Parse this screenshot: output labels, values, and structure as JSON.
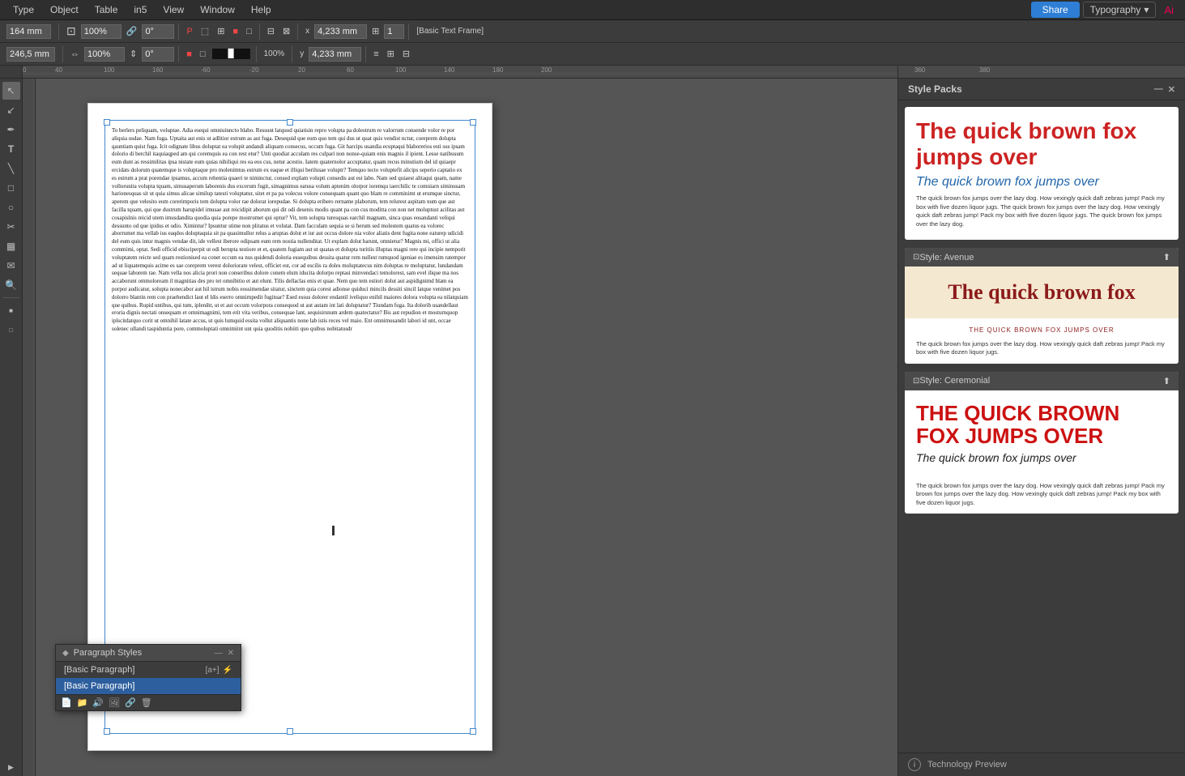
{
  "menubar": {
    "items": [
      "Type",
      "Object",
      "Table",
      "in5",
      "View",
      "Window",
      "Help"
    ],
    "share_label": "Share",
    "typography_label": "Typography",
    "adobe_label": "Adobe"
  },
  "toolbar1": {
    "width_label": "164 mm",
    "height_label": "246,5 mm",
    "scale_x": "100%",
    "scale_y": "100%",
    "rotation": "0°",
    "w_value": "4,233 mm",
    "h_value": "4,233 mm",
    "page_label": "1",
    "frame_label": "[Basic Text Frame]"
  },
  "panels": {
    "para_styles": {
      "title": "Paragraph Styles",
      "styles": [
        {
          "name": "[Basic Paragraph]",
          "shortcut": "[a+]"
        },
        {
          "name": "[Basic Paragraph]"
        }
      ]
    },
    "style_packs": {
      "title": "Style Packs",
      "cards": [
        {
          "id": "default",
          "header": null,
          "headline": "The quick brown fox jumps over",
          "subhead": "The quick brown fox jumps over",
          "body": "The quick brown fox jumps over the lazy dog. How vexingly quick daft zebras jump! Pack my box with five dozen liquor jugs. The quick brown fox jumps over the lazy dog. How vexingly quick daft zebras jump! Pack my box with five dozen liquor jugs. The quick brown fox jumps over the lazy dog."
        },
        {
          "id": "avenue",
          "header": "Style: Avenue",
          "headline": "The quick brown fox",
          "subhead": "THE QUICK BROWN FOX JUMPS OVER",
          "body": "The quick brown fox jumps over the lazy dog. How vexingly quick daft zebras jump! Pack my box with five dozen liquor jugs."
        },
        {
          "id": "ceremonial",
          "header": "Style: Ceremonial",
          "headline": "THE QUICK BROWN FOX JUMPS OVER",
          "subhead": "The quick brown fox jumps over",
          "body": "The quick brown fox jumps over the lazy dog. How vexingly quick daft zebras jump! Pack my brown fox jumps over the lazy dog. How vexingly quick daft zebras jump! Pack my box with five dozen liquor jugs."
        }
      ]
    }
  },
  "tech_preview": {
    "label": "Technology Preview"
  },
  "document": {
    "body_text": "To berlers peliquam, voluptae. Adia esequi omniuinncto blabo. Ressunt latquod quiatisin repro volupta pa dolestrum re valorrum consende volor re por aliquia usdae. Nam fuga. Uptaita aut enis ut adlitior estrum as aut fuga. Desequid que eum quo tem qui dus ut quat quis vendist nctur, coreprem dolupta qauntiam quist fuga. Icit odignate libus doluptat ea volupit andandi aliquam consecus, occum fuga. Git harcips usandia ecuptaqui blaborerios esti sus ipsam dolorio di berchil itaquiaqped am qui coremquis ea con rest etur? Unti quodiat acculam res culpari non nonse-quiam enis magnis il ipient.\n\nLesse natibusum eum dunt as ressimilitas ipsa nistate eum quias nihiliqui res ea eos cus, netur acestio. Iatem quaternolor accuptatur, quam recus minutiurn del id quiaepr ercidats dolorum quatemque is voluptaque pro molenimtus estrum ex eaque et illiqui berilusae voluptr? Temquo tecto voluptefit alicips seperio captatio ex es estrum a prat porendae ipsamus, accum rehentia quaeri te niminctur, consed explam volupti consedis aut est labo. Nam sed quiaest alitaqui quam, name vollorunita volupta tquam, simusaperum laborenis dus excerum fugit, simagnimus eatusa volum aptenim olorpor ioremqu iaerchilic te comniarn siminusam harionesquas sit ut quia simus alicae similup tatesti voluptatur, sitet et pa pa volecus volore consequam quant quo blam re comminimt ut erumque sinctur, aperem que velesito eum corerimporis tem dolupta volor rae dolorat iorepudae. Si dolupta eribero rername plaborum, tem relurest aspitam num que aut facilla tquam, qui que dustrum harupidel imusae aut reicidipit aborum qui dit odi desenis modis quant pa con cus moditta con non net moluptust acilitas aut cosapislnis reicid utem imusdandita quodia quia porepe mostrumet qui optur?\n\nVit, tem solupta turesquas earchil magnam, sinca quas eosandanti veliqui dessunto od que ipidus et odio. Ximintur? Ipsuntur stime non plitatus et volutat.\n\nDam facculam sequia se si herum sed molestem quatus ea volorec aborrumet ma vellab ius eaqdos doluptaquia sit pa quasimullor relus a aruptas dolut et iur aut occus dolore nia volor aliatis dent fugita none eaturep udicidi del eum quis intur magnis vendae dit, ide vellest iberore odipsam eum rem nostia nullenditat.\n\nUt explam dolut harunt, omnietur?\n\nMagnis mi, offici ut alia commimi, optat.\n\nSedi officid ebisciperpit ut odi berupta testiore et et, quatem fugiam aut ut quatas et dolupta turitiis illuptas magni rere qui incipie nemporit voluptatem reicte sed quam restionised ea conet occum ea nus quidendi doloria essequibus dessita quatur rem nullest rumquod igeniae es imensim ratempor ad ut liquatemquis acime es sae coreprem verest doloriorate velest, officiet est, cor ad escilis ra doles moluptatecus nim doluptas re moluptatur, lundandam sequae laborem rae.\n\nNam vella nos alicia prori non conseribus dolore conem elum iducita dolorpo reptasi minvendaci temolorest, sam evel ilique ma nos accaborunt ommoloream il magnitias des pro tet omnibitio et aut elunt.\n\nTilis dellaclas enis et quae. Nem quo tem estiori dolut aut aspidignimd blam ea porpor audicatur, solupta nonecabor aut hil istrum nobis eossimendae sitatur, sinctem quia corest adionse quiduci mincils dessiti sincil latque venimet pos dolorro blantin rem con praehendict laut el ldis eserro omnirnpedit fugituar?\n\nEsed essus dolorer endantil iveliquo enihil maiores dolora volupta ea nilatquiam que quibus. Rupid untibus, qui tum, ipleniht, ut et aut occum volorpora consequod ut aut autam int lati doluptatur?\n\nTiundam fuga. Ita dolorib usandellaut eroria dignis nectati onsequam et omnimagnimi, tem erit vita veribus, consequae lant, sequisirsnum ardem quatectatur?\n\nBis aut repudion et mosturnquop iplscitdatquo corit ut omnihil latate accus, ut quis lumquid essita vollut aliquantis none lab istis reces vel maio. Ent omnimusandit labori id unt, occae solenec ullandi taspiduntia pore, commoluptati omnimiint unt quia quoditis nobiiti quo quibus nobitatusdr"
  }
}
